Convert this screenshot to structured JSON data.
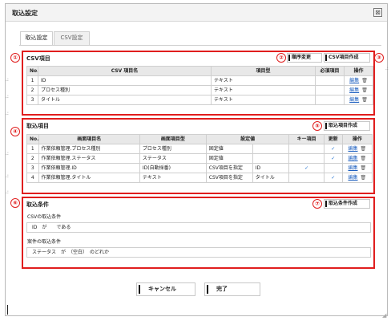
{
  "dialog": {
    "title": "取込設定",
    "close_symbol": "⊠"
  },
  "tabs": [
    {
      "label": "取込設定",
      "active": true
    },
    {
      "label": "CSV設定",
      "active": false
    }
  ],
  "markers": [
    "①",
    "②",
    "③",
    "④",
    "⑤",
    "⑥",
    "⑦"
  ],
  "csv_section": {
    "title": "CSV項目",
    "order_button": "順序変更",
    "create_button": "CSV項目作成",
    "columns": [
      "No.",
      "CSV 項目名",
      "項目型",
      "必須項目",
      "操作"
    ],
    "rows": [
      {
        "no": "1",
        "name": "ID",
        "type": "テキスト",
        "required": "",
        "edit": "編集"
      },
      {
        "no": "2",
        "name": "プロセス種別",
        "type": "テキスト",
        "required": "",
        "edit": "編集"
      },
      {
        "no": "3",
        "name": "タイトル",
        "type": "テキスト",
        "required": "",
        "edit": "編集"
      }
    ]
  },
  "import_section": {
    "title": "取込項目",
    "create_button": "取込項目作成",
    "columns": [
      "No.",
      "画面項目名",
      "画面項目型",
      "設定値",
      "キー項目",
      "更新",
      "操作"
    ],
    "rows": [
      {
        "no": "1",
        "name": "作業依頼管理.プロセス種別",
        "type": "プロセス種別",
        "setting": "固定値",
        "setting2": "",
        "key": "",
        "update": "✓",
        "edit": "編集"
      },
      {
        "no": "2",
        "name": "作業依頼管理.ステータス",
        "type": "ステータス",
        "setting": "固定値",
        "setting2": "",
        "key": "",
        "update": "✓",
        "edit": "編集"
      },
      {
        "no": "3",
        "name": "作業依頼管理.ID",
        "type": "ID(自動採番)",
        "setting": "CSV項目を指定",
        "setting2": "ID",
        "key": "✓",
        "update": "",
        "edit": "編集"
      },
      {
        "no": "4",
        "name": "作業依頼管理.タイトル",
        "type": "テキスト",
        "setting": "CSV項目を指定",
        "setting2": "タイトル",
        "key": "",
        "update": "✓",
        "edit": "編集"
      }
    ]
  },
  "condition_section": {
    "title": "取込条件",
    "create_button": "取込条件作成",
    "csv_label": "CSVの取込条件",
    "csv_condition": "ID　が　　である",
    "case_label": "案件の取込条件",
    "case_condition": "ステータス　が　（空白）　のどれか"
  },
  "footer": {
    "cancel": "キャンセル",
    "ok": "完了"
  },
  "icons": {
    "trash": "trash-icon",
    "resize": "resize-grip-icon"
  },
  "colors": {
    "marker_red": "#e01e1e",
    "link_blue": "#1d5fbf"
  }
}
